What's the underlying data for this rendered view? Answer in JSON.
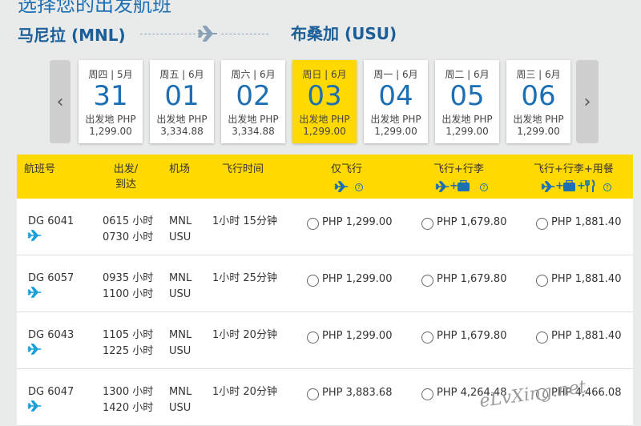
{
  "header": {
    "title": "选择您的出发航班",
    "origin": "马尼拉 (MNL)",
    "destination": "布桑加 (USU)"
  },
  "dates": [
    {
      "label": "周四 | 5月",
      "day": "31",
      "from": "出发地 PHP",
      "price": "1,299.00",
      "active": false
    },
    {
      "label": "周五 | 6月",
      "day": "01",
      "from": "出发地 PHP",
      "price": "3,334.88",
      "active": false
    },
    {
      "label": "周六 | 6月",
      "day": "02",
      "from": "出发地 PHP",
      "price": "3,334.88",
      "active": false
    },
    {
      "label": "周日 | 6月",
      "day": "03",
      "from": "出发地 PHP",
      "price": "1,299.00",
      "active": true
    },
    {
      "label": "周一 | 6月",
      "day": "04",
      "from": "出发地 PHP",
      "price": "1,299.00",
      "active": false
    },
    {
      "label": "周二 | 6月",
      "day": "05",
      "from": "出发地 PHP",
      "price": "1,299.00",
      "active": false
    },
    {
      "label": "周三 | 6月",
      "day": "06",
      "from": "出发地 PHP",
      "price": "1,299.00",
      "active": false
    }
  ],
  "table": {
    "headers": {
      "flight": "航班号",
      "depart": "出发/",
      "arrive": "到达",
      "airport": "机场",
      "duration": "飞行时间",
      "fare1": "仅飞行",
      "fare2": "飞行+行李",
      "fare3": "飞行+行李+用餐"
    },
    "rows": [
      {
        "flight": "DG 6041",
        "dep": "0615 小时",
        "arr": "0730 小时",
        "from": "MNL",
        "to": "USU",
        "duration": "1小时 15分钟",
        "p1": "PHP 1,299.00",
        "p2": "PHP 1,679.80",
        "p3": "PHP 1,881.40"
      },
      {
        "flight": "DG 6057",
        "dep": "0935 小时",
        "arr": "1100 小时",
        "from": "MNL",
        "to": "USU",
        "duration": "1小时 25分钟",
        "p1": "PHP 1,299.00",
        "p2": "PHP 1,679.80",
        "p3": "PHP 1,881.40"
      },
      {
        "flight": "DG 6043",
        "dep": "1105 小时",
        "arr": "1225 小时",
        "from": "MNL",
        "to": "USU",
        "duration": "1小时 20分钟",
        "p1": "PHP 1,299.00",
        "p2": "PHP 1,679.80",
        "p3": "PHP 1,881.40"
      },
      {
        "flight": "DG 6047",
        "dep": "1300 小时",
        "arr": "1420 小时",
        "from": "MNL",
        "to": "USU",
        "duration": "1小时 20分钟",
        "p1": "PHP 3,883.68",
        "p2": "PHP 4,264.48",
        "p3": "PHP 4,466.08"
      }
    ]
  },
  "watermark": "eLvXing.net",
  "colors": {
    "accent": "#ffd900",
    "brand": "#1c6fb3"
  },
  "icons": {
    "plane": "plane-icon",
    "bag": "baggage-icon",
    "meal": "meal-icon",
    "info": "info-icon"
  }
}
